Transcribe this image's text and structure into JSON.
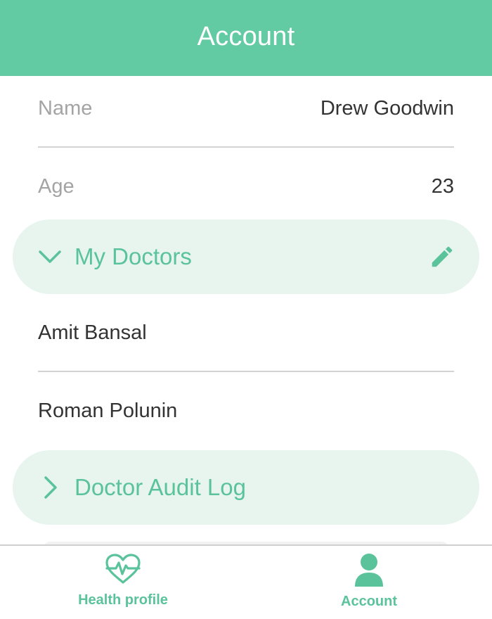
{
  "header": {
    "title": "Account"
  },
  "profile": {
    "name_label": "Name",
    "name_value": "Drew Goodwin",
    "age_label": "Age",
    "age_value": "23"
  },
  "sections": {
    "my_doctors": {
      "label": "My Doctors",
      "expanded": true,
      "icon": "chevron-down-icon",
      "action_icon": "pencil-icon"
    },
    "doctor_audit_log": {
      "label": "Doctor Audit Log",
      "expanded": false,
      "icon": "chevron-right-icon"
    }
  },
  "doctors": [
    "Amit Bansal",
    "Roman Polunin"
  ],
  "tabbar": {
    "tabs": [
      {
        "label": "Health profile",
        "icon": "heart-pulse-icon"
      },
      {
        "label": "Account",
        "icon": "person-icon"
      }
    ]
  },
  "colors": {
    "accent": "#63CBA3",
    "accent_text": "#5BC39B",
    "section_bg": "#E8F5EF",
    "label_gray": "#A4A4A4",
    "text_dark": "#333333",
    "divider": "#D3D3D3"
  }
}
